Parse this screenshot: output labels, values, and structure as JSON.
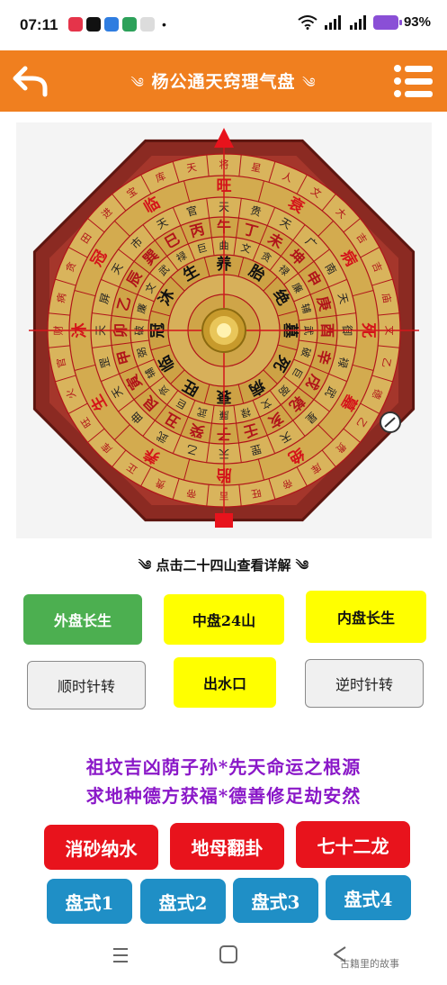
{
  "status": {
    "time": "07:11",
    "battery": "93%",
    "net1": "5G",
    "net2": "5G"
  },
  "header": {
    "title": "杨公通天窍理气盘",
    "back_icon": "back-arrow-icon",
    "menu_icon": "menu-icon"
  },
  "compass": {
    "outer_ring": [
      "将",
      "星",
      "人",
      "文",
      "大",
      "吉",
      "库",
      "曲",
      "宝",
      "库",
      "进",
      "田",
      "进",
      "财",
      "贪",
      "中",
      "帝",
      "旺",
      "正",
      "贵",
      "狼",
      "天",
      "官",
      "文",
      "贵"
    ],
    "outer_ring_full": [
      "将",
      "星",
      "人",
      "文",
      "大",
      "吉",
      "吉",
      "庙",
      "文",
      "乙",
      "德",
      "乙",
      "贵",
      "库",
      "帝",
      "旺",
      "吉",
      "帝",
      "贵",
      "正",
      "库",
      "旺",
      "火",
      "官",
      "财",
      "病",
      "贪",
      "田",
      "进",
      "宝",
      "库",
      "天",
      "官"
    ],
    "stage_big": [
      "旺",
      "衰",
      "病",
      "死",
      "墓",
      "绝",
      "胎",
      "养",
      "生",
      "沐",
      "冠",
      "临"
    ],
    "mountains_24": [
      "午",
      "丁",
      "未",
      "坤",
      "申",
      "庚",
      "酉",
      "辛",
      "戌",
      "乾",
      "亥",
      "壬",
      "子",
      "癸",
      "丑",
      "艮",
      "寅",
      "甲",
      "卯",
      "乙",
      "辰",
      "巽",
      "巳",
      "丙"
    ],
    "inner_stage": [
      "养",
      "胎",
      "绝",
      "墓",
      "死",
      "病",
      "衰",
      "旺",
      "临",
      "冠",
      "沐",
      "生"
    ],
    "mid_ring": [
      "天",
      "贵",
      "天",
      "广",
      "南",
      "天",
      "御",
      "禄",
      "武",
      "星",
      "天",
      "罡",
      "天",
      "乙",
      "武",
      "曲",
      "天",
      "罡",
      "天",
      "屏",
      "天",
      "市",
      "天",
      "官"
    ],
    "line_ring": [
      "曲",
      "文",
      "贪",
      "禄",
      "廉",
      "辅",
      "武",
      "破",
      "巨",
      "弼",
      "文",
      "禄",
      "廉",
      "武",
      "巨",
      "贪",
      "辅",
      "弼",
      "破",
      "廉",
      "文",
      "武",
      "禄",
      "巨"
    ],
    "pointer_marker": "north-pointer",
    "bottom_marker": "south-marker",
    "dial_icon": "compass-dial-icon"
  },
  "subtitle": {
    "text": "点击二十四山查看详解",
    "ornament_left": "༄",
    "ornament_right": "༄"
  },
  "buttons": {
    "outer": "外盘长生",
    "middle": "中盘24山",
    "inner": "内盘长生",
    "cw": "顺时针转",
    "water": "出水口",
    "ccw": "逆时针转"
  },
  "poem": {
    "line1": "祖坟吉凶荫子孙*先天命运之根源",
    "line2": "求地种德方获福*德善修足劫安然"
  },
  "tools": {
    "sha": "消砂纳水",
    "dimu": "地母翻卦",
    "qishier": "七十二龙"
  },
  "pan": {
    "p1": "盘式1",
    "p2": "盘式2",
    "p3": "盘式3",
    "p4": "盘式4"
  },
  "watermark": "古籍里的故事",
  "colors": {
    "header": "#f07f1f",
    "compass_gold": "#c8a24a",
    "compass_frame": "#8b2a22",
    "red_text": "#d4141a",
    "poem": "#8a18c8"
  }
}
